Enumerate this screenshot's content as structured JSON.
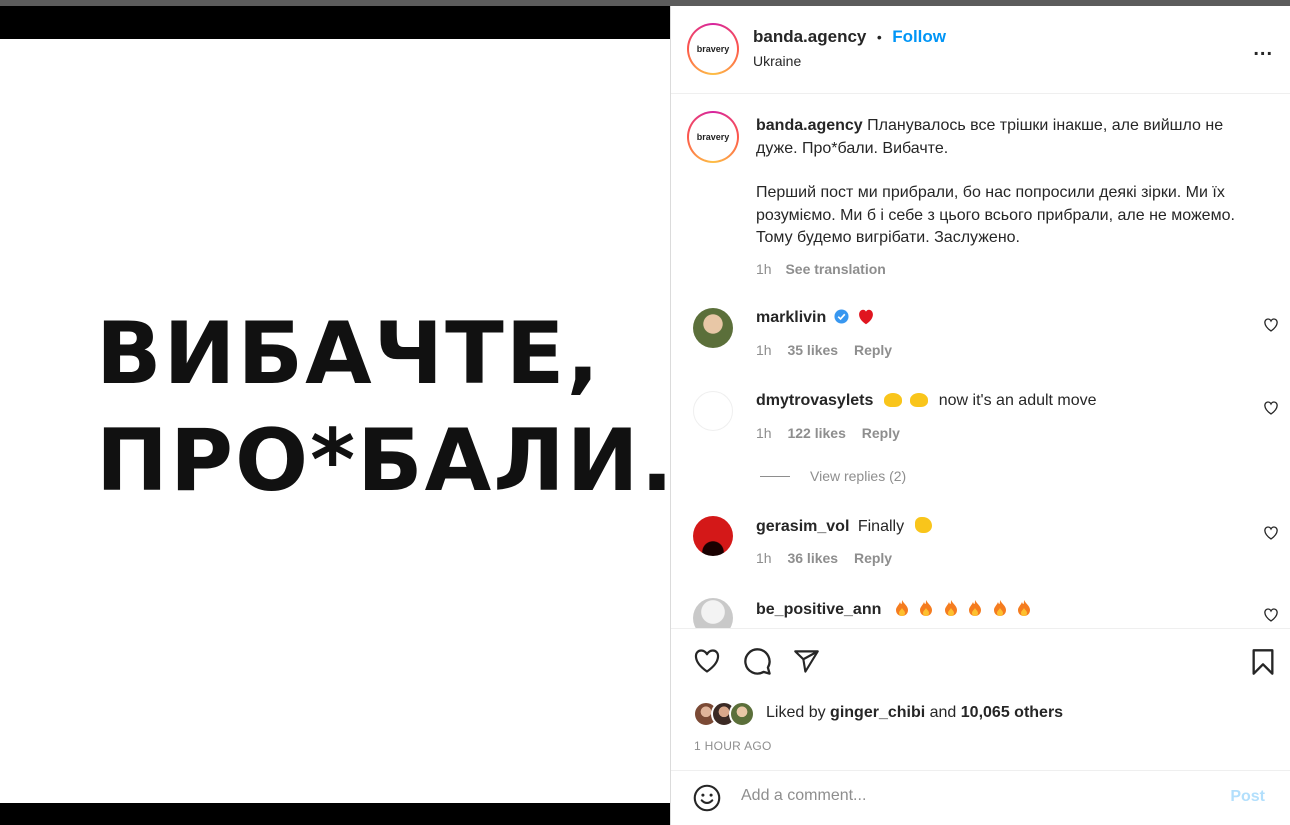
{
  "post": {
    "image_text_line1": "ВИБАЧТЕ,",
    "image_text_line2": "ПРО*БАЛИ."
  },
  "header": {
    "avatar_text": "bravery",
    "username": "banda.agency",
    "dot": "•",
    "follow": "Follow",
    "location": "Ukraine",
    "more": "..."
  },
  "caption": {
    "username": "banda.agency",
    "text1": "Планувалось все трішки інакше, але вийшло не дуже. Про*бали. Вибачте.",
    "text2": "Перший пост ми прибрали, бо нас попросили деякі зірки. Ми їх розуміємо. Ми б і себе з цього всього прибрали, але не можемо. Тому будемо вигрібати. Заслужено.",
    "time": "1h",
    "see_translation": "See translation"
  },
  "comments": [
    {
      "username": "marklivin",
      "text": "",
      "time": "1h",
      "likes": "35 likes",
      "reply": "Reply"
    },
    {
      "username": "dmytrovasylets",
      "text": "now it's an adult move",
      "time": "1h",
      "likes": "122 likes",
      "reply": "Reply",
      "view_replies": "View replies (2)"
    },
    {
      "username": "gerasim_vol",
      "text": "Finally",
      "time": "1h",
      "likes": "36 likes",
      "reply": "Reply"
    },
    {
      "username": "be_positive_ann",
      "text": ""
    }
  ],
  "likes": {
    "prefix": "Liked by",
    "user": "ginger_chibi",
    "and": "and",
    "others": "10,065 others"
  },
  "timestamp": "1 HOUR AGO",
  "add_comment": {
    "placeholder": "Add a comment...",
    "post": "Post"
  },
  "colors": {
    "accent": "#0095f6",
    "heart_red": "#ed4956",
    "verified": "#3897f0"
  }
}
